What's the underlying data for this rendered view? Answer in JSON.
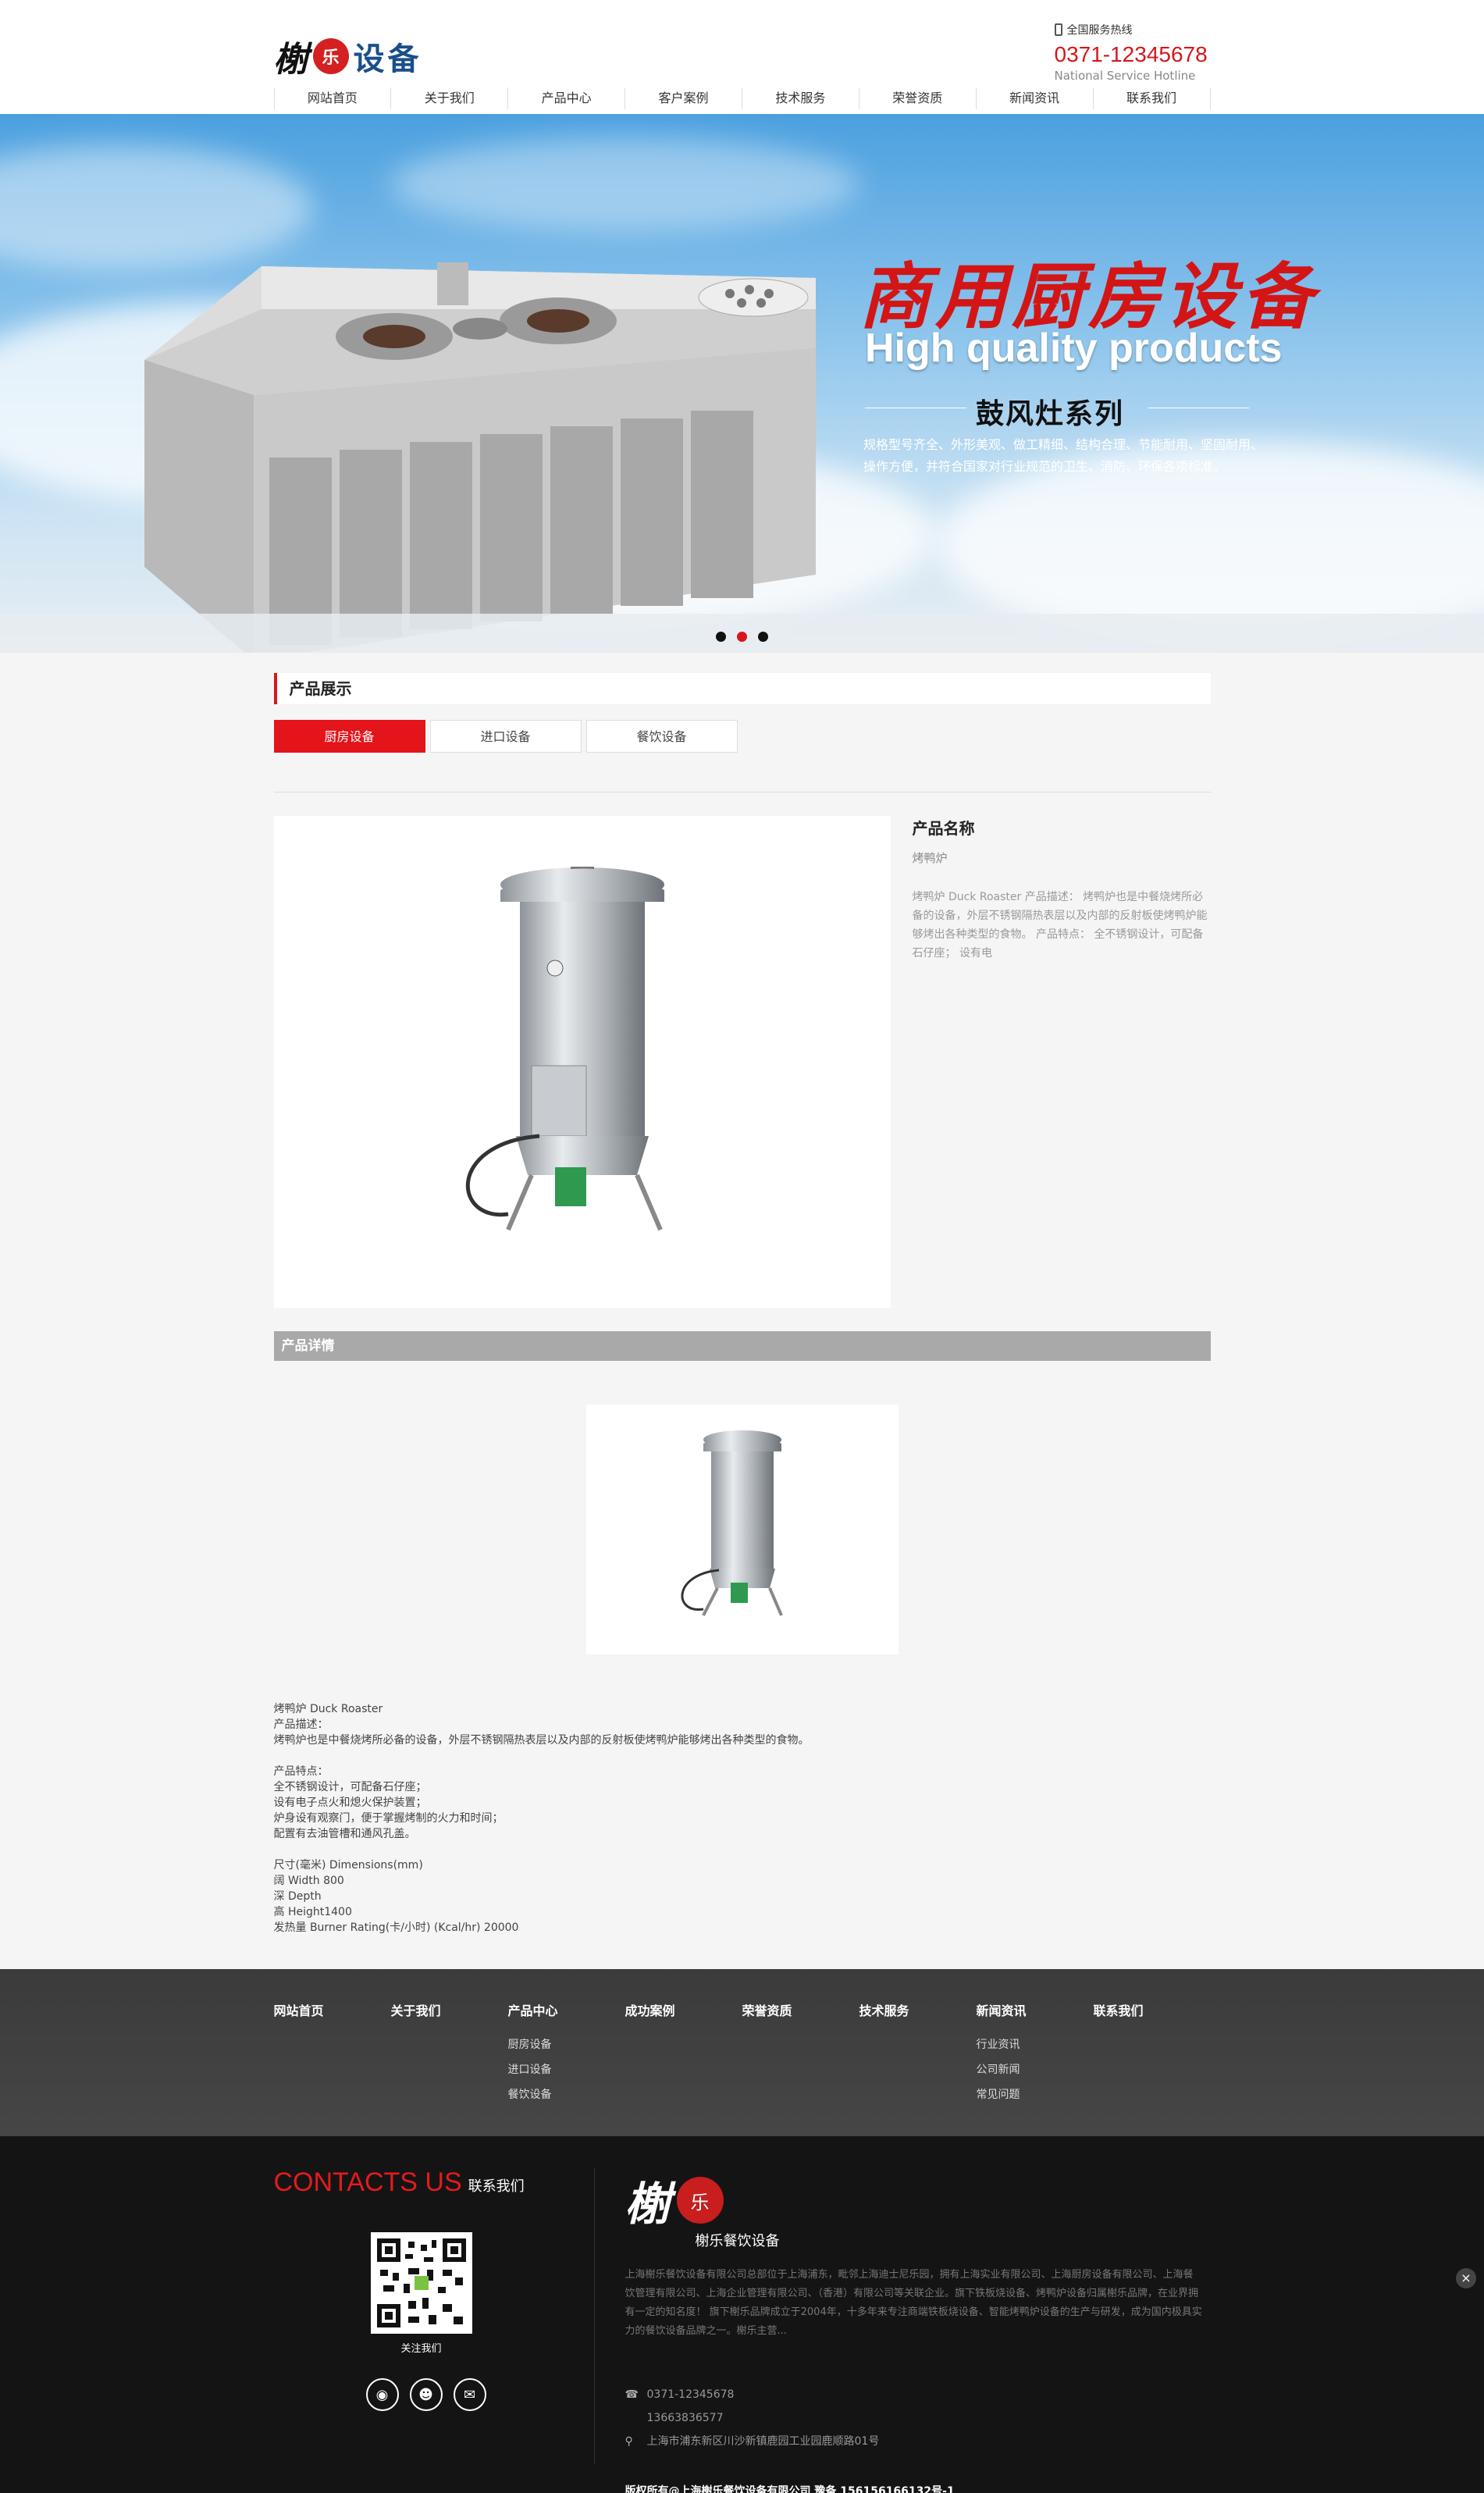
{
  "header": {
    "logo_char": "榭",
    "logo_seal": "乐",
    "logo_word": "设备",
    "hotline_label": "全国服务热线",
    "hotline_number": "0371-12345678",
    "hotline_sub": "National Service Hotline"
  },
  "nav": [
    "网站首页",
    "关于我们",
    "产品中心",
    "客户案例",
    "技术服务",
    "荣誉资质",
    "新闻资讯",
    "联系我们"
  ],
  "banner": {
    "headline": "商用厨房设备",
    "subtitle": "High quality products",
    "series": "鼓风灶系列",
    "desc": "规格型号齐全、外形美观、做工精细、结构合理、节能耐用、坚固耐用、操作方便，并符合国家对行业规范的卫生、消防、环保各项标准。",
    "dots": [
      false,
      true,
      false
    ]
  },
  "section": {
    "title": "产品展示",
    "tabs": [
      "厨房设备",
      "进口设备",
      "餐饮设备"
    ],
    "active_tab": 0
  },
  "product": {
    "name_label": "产品名称",
    "name": "烤鸭炉",
    "desc": "烤鸭炉 Duck Roaster 产品描述： 烤鸭炉也是中餐烧烤所必备的设备，外层不锈钢隔热表层以及内部的反射板使烤鸭炉能够烤出各种类型的食物。 产品特点： 全不锈钢设计，可配备石仔座； 设有电"
  },
  "detail": {
    "title": "产品详情",
    "text": "烤鸭炉 Duck Roaster\n产品描述：\n烤鸭炉也是中餐烧烤所必备的设备，外层不锈钢隔热表层以及内部的反射板使烤鸭炉能够烤出各种类型的食物。\n\n产品特点：\n全不锈钢设计，可配备石仔座；\n设有电子点火和熄火保护装置；\n炉身设有观察门，便于掌握烤制的火力和时间；\n配置有去油管槽和通风孔盖。\n\n尺寸(毫米) Dimensions(mm)\n阔 Width 800\n深 Depth\n高 Height1400\n发热量  Burner  Rating(卡/小时) (Kcal/hr)    20000"
  },
  "footer_nav": [
    {
      "title": "网站首页",
      "subs": []
    },
    {
      "title": "关于我们",
      "subs": []
    },
    {
      "title": "产品中心",
      "subs": [
        "厨房设备",
        "进口设备",
        "餐饮设备"
      ]
    },
    {
      "title": "成功案例",
      "subs": []
    },
    {
      "title": "荣誉资质",
      "subs": []
    },
    {
      "title": "技术服务",
      "subs": []
    },
    {
      "title": "新闻资讯",
      "subs": [
        "行业资讯",
        "公司新闻",
        "常见问题"
      ]
    },
    {
      "title": "联系我们",
      "subs": []
    }
  ],
  "footer": {
    "contact_en": "CONTACTS US",
    "contact_cn": "联系我们",
    "qr_label": "关注我们",
    "logo_char": "榭",
    "logo_seal": "乐",
    "logo_sub": "榭乐餐饮设备",
    "company": "上海榭乐餐饮设备有限公司总部位于上海浦东，毗邻上海迪士尼乐园，拥有上海实业有限公司、上海厨房设备有限公司、上海餐饮管理有限公司、上海企业管理有限公司、（香港）有限公司等关联企业。旗下铁板烧设备、烤鸭炉设备归属榭乐品牌，在业界拥有一定的知名度！ 旗下榭乐品牌成立于2004年，十多年来专注商端铁板烧设备、智能烤鸭炉设备的生产与研发，成为国内极具实力的餐饮设备品牌之一。榭乐主营...",
    "phone1": "0371-12345678",
    "phone2": "13663836577",
    "address": "上海市浦东新区川沙新镇鹿园工业园鹿顺路01号",
    "copyright": "版权所有@上海榭乐餐饮设备有限公司  豫备 15615616613​2号-1"
  }
}
